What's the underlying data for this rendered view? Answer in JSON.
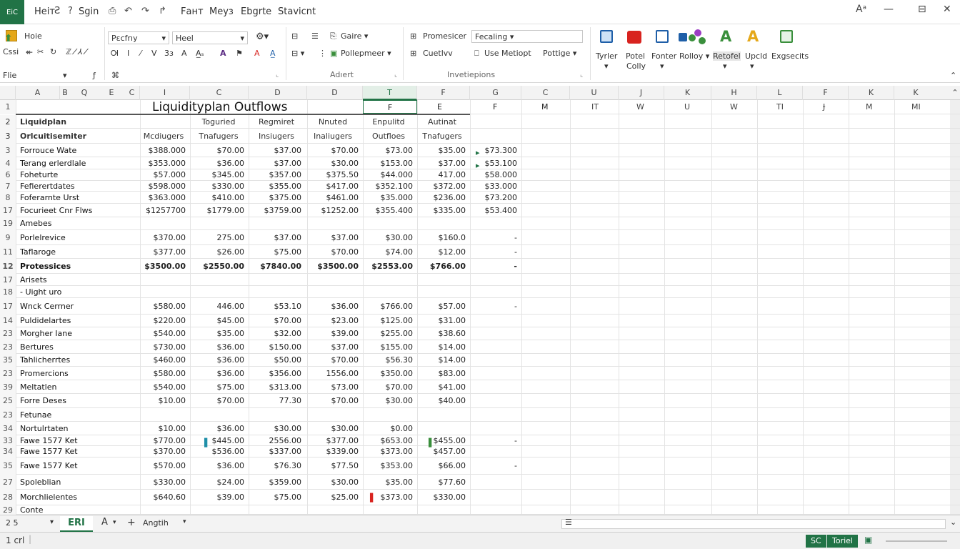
{
  "titlebar": {
    "badge": "EiC",
    "menu": [
      "Heiт",
      "Sgin",
      "Fант",
      "Meyз",
      "Ebgrte",
      "Stavicnt"
    ],
    "quick_icons": [
      "Ƨ",
      "?",
      "⎙",
      "↶",
      "↷",
      "↱"
    ],
    "controls": [
      "Aᵃ",
      "—",
      "⊟",
      "✕"
    ]
  },
  "ribbon": {
    "clipboard": {
      "home": "Hoie",
      "paste": "Cꜱsi",
      "icons": [
        "✂",
        "↻"
      ]
    },
    "font": {
      "font_name": "Pεcfrıy",
      "font_size": "Heel",
      "row2": [
        "Ꮊ",
        "I",
        "⁄",
        "V",
        "3ɜ",
        "A",
        "A̲ₛ",
        "A",
        "⚑",
        "A"
      ]
    },
    "alignment": {
      "label": "Adıert",
      "wrap": "Gaire ▾",
      "merge": "Pollepmeer ▾",
      "launcher": "⌞"
    },
    "number": {
      "promote": "Promesicer",
      "format_box": "Fecaling ▾",
      "custom": "Cuetlvv",
      "use_methods": "Use Metiopt",
      "position": "Pottige ▾",
      "group_label": "Invetiepions",
      "launcher": "⌞"
    },
    "styles": {
      "items": [
        {
          "label": "Tyrler",
          "sub": "▾"
        },
        {
          "label": "Potel",
          "sub": "Colly"
        },
        {
          "label": "Fonter",
          "sub": "▾"
        },
        {
          "label": "Rolloy ▾",
          "sub": ""
        },
        {
          "label": "Retofel",
          "sub": "▾"
        },
        {
          "label": "Upcld",
          "sub": "▾"
        },
        {
          "label": "Exgsecits",
          "sub": ""
        }
      ]
    }
  },
  "formula_bar": {
    "name_box": "Flie",
    "fx": "ƒ",
    "check": "⌘"
  },
  "colors": {
    "accent": "#217346",
    "blue": "#1f5fa8",
    "red": "#d8231f",
    "gold": "#e5a81a",
    "green": "#3a8f3c"
  },
  "col_headers": [
    "A",
    "B",
    "Q",
    "E",
    "C",
    "I",
    "C",
    "D",
    "D",
    "T",
    "F",
    "G",
    "C",
    "U",
    "J",
    "K",
    "H",
    "L",
    "F",
    "K"
  ],
  "row2_headers": [
    "IT",
    "W",
    "U",
    "W",
    "TI",
    "Ɉ",
    "M",
    "MI"
  ],
  "sheet": {
    "title": "Liquidityplan  Outflows",
    "title_cells": [
      "E",
      "F",
      "F",
      "M"
    ],
    "rows": [
      {
        "n": "2",
        "label": "Liquidplan",
        "vals": [
          "",
          "Toguried",
          "Regmiret",
          "Nnuted",
          "Enpulitd",
          "Autinat",
          ""
        ],
        "type": "head"
      },
      {
        "n": "3",
        "label": "Orlcuitisemiter",
        "vals": [
          "Mcdiugers",
          "Tnafugers",
          "Insiugers",
          "Inaliugers",
          "Outfloes",
          "Tnafugers",
          ""
        ],
        "type": "head"
      },
      {
        "n": "3",
        "label": "Forrouce Wate",
        "vals": [
          "$388.000",
          "$70.00",
          "$37.00",
          "$70.00",
          "$73.00",
          "$35.00",
          "$73.300"
        ],
        "type": "data"
      },
      {
        "n": "4",
        "label": "Terang erlerdlale",
        "vals": [
          "$353.000",
          "$36.00",
          "$37.00",
          "$30.00",
          "$153.00",
          "$37.00",
          "$53.100"
        ],
        "type": "data"
      },
      {
        "n": "6",
        "label": "Foheturte",
        "vals": [
          "$57.000",
          "$345.00",
          "$357.00",
          "$375.50",
          "$44.000",
          "417.00",
          "$58.000"
        ],
        "type": "data"
      },
      {
        "n": "7",
        "label": "Fefierertdates",
        "vals": [
          "$598.000",
          "$330.00",
          "$355.00",
          "$417.00",
          "$352.100",
          "$372.00",
          "$33.000"
        ],
        "type": "data"
      },
      {
        "n": "8",
        "label": "Foferarnte Urst",
        "vals": [
          "$363.000",
          "$410.00",
          "$375.00",
          "$461.00",
          "$35.000",
          "$236.00",
          "$73.200"
        ],
        "type": "data"
      },
      {
        "n": "17",
        "label": "Focurieet Cnr Flws",
        "vals": [
          "$1257700",
          "$1779.00",
          "$3759.00",
          "$1252.00",
          "$355.400",
          "$335.00",
          "$53.400"
        ],
        "type": "data"
      },
      {
        "n": "19",
        "label": "Amebes",
        "vals": [
          "",
          "",
          "",
          "",
          "",
          "",
          ""
        ],
        "type": "section"
      },
      {
        "n": "9",
        "label": "Porlelrevice",
        "vals": [
          "$370.00",
          "275.00",
          "$37.00",
          "$37.00",
          "$30.00",
          "$160.0",
          "-"
        ],
        "type": "data"
      },
      {
        "n": "11",
        "label": "Taflaroge",
        "vals": [
          "$377.00",
          "$26.00",
          "$75.00",
          "$70.00",
          "$74.00",
          "$12.00",
          "-"
        ],
        "type": "data"
      },
      {
        "n": "12",
        "label": "Protessices",
        "vals": [
          "$3500.00",
          "$2550.00",
          "$7840.00",
          "$3500.00",
          "$2553.00",
          "$766.00",
          "-"
        ],
        "type": "total"
      },
      {
        "n": "17",
        "label": "Arisets",
        "vals": [
          "",
          "",
          "",
          "",
          "",
          "",
          ""
        ],
        "type": "section"
      },
      {
        "n": "18",
        "label": "- Uight uro",
        "vals": [
          "",
          "",
          "",
          "",
          "",
          "",
          ""
        ],
        "type": "section"
      },
      {
        "n": "17",
        "label": "Wnck Cerrner",
        "vals": [
          "$580.00",
          "446.00",
          "$53.10",
          "$36.00",
          "$766.00",
          "$57.00",
          "-"
        ],
        "type": "data"
      },
      {
        "n": "14",
        "label": "Puldidelartes",
        "vals": [
          "$220.00",
          "$45.00",
          "$70.00",
          "$23.00",
          "$125.00",
          "$31.00",
          ""
        ],
        "type": "data"
      },
      {
        "n": "23",
        "label": "Morgher Iane",
        "vals": [
          "$540.00",
          "$35.00",
          "$32.00",
          "$39.00",
          "$255.00",
          "$38.60",
          ""
        ],
        "type": "data"
      },
      {
        "n": "23",
        "label": "Bertures",
        "vals": [
          "$730.00",
          "$36.00",
          "$150.00",
          "$37.00",
          "$155.00",
          "$14.00",
          ""
        ],
        "type": "data"
      },
      {
        "n": "35",
        "label": "Tahlicherrtes",
        "vals": [
          "$460.00",
          "$36.00",
          "$50.00",
          "$70.00",
          "$56.30",
          "$14.00",
          ""
        ],
        "type": "data"
      },
      {
        "n": "23",
        "label": "Promercions",
        "vals": [
          "$580.00",
          "$36.00",
          "$356.00",
          "1556.00",
          "$350.00",
          "$83.00",
          ""
        ],
        "type": "data"
      },
      {
        "n": "39",
        "label": "Meltatlen",
        "vals": [
          "$540.00",
          "$75.00",
          "$313.00",
          "$73.00",
          "$70.00",
          "$41.00",
          ""
        ],
        "type": "data"
      },
      {
        "n": "25",
        "label": "Forre Deses",
        "vals": [
          "$10.00",
          "$70.00",
          "77.30",
          "$70.00",
          "$30.00",
          "$40.00",
          ""
        ],
        "type": "data"
      },
      {
        "n": "23",
        "label": "Fetunae",
        "vals": [
          "",
          "",
          "",
          "",
          "",
          "",
          ""
        ],
        "type": "section"
      },
      {
        "n": "34",
        "label": "Nortulrtaten",
        "vals": [
          "$10.00",
          "$36.00",
          "$30.00",
          "$30.00",
          "$0.00",
          "",
          ""
        ],
        "type": "data"
      },
      {
        "n": "33",
        "label": "Fawe 1577 Ket",
        "vals": [
          "$770.00",
          "$445.00",
          "2556.00",
          "$377.00",
          "$653.00",
          "$455.00",
          "-"
        ],
        "type": "data"
      },
      {
        "n": "34",
        "label": "Fawe 1577 Ket",
        "vals": [
          "$370.00",
          "$536.00",
          "$337.00",
          "$339.00",
          "$373.00",
          "$457.00",
          ""
        ],
        "type": "data"
      },
      {
        "n": "35",
        "label": "Fawe 1577 Ket",
        "vals": [
          "$570.00",
          "$36.00",
          "$76.30",
          "$77.50",
          "$353.00",
          "$66.00",
          "-"
        ],
        "type": "data"
      },
      {
        "n": "27",
        "label": "Spoleblian",
        "vals": [
          "$330.00",
          "$24.00",
          "$359.00",
          "$30.00",
          "$35.00",
          "$77.60",
          ""
        ],
        "type": "data"
      },
      {
        "n": "28",
        "label": "Morchlielentes",
        "vals": [
          "$640.60",
          "$39.00",
          "$75.00",
          "$25.00",
          "$373.00",
          "$330.00",
          ""
        ],
        "type": "data"
      },
      {
        "n": "29",
        "label": "Conte",
        "vals": [
          "",
          "",
          "",
          "",
          "",
          "",
          ""
        ],
        "type": "section"
      }
    ]
  },
  "bottombar": {
    "cell_ref": "2 5",
    "sheet_tab": "ERI",
    "tab2": "A",
    "add": "+",
    "tab3": "Angtih"
  },
  "statusbar": {
    "left": "1 crl",
    "chip1": "SC",
    "chip2": "Toriel",
    "zoom_icon": "▣"
  }
}
